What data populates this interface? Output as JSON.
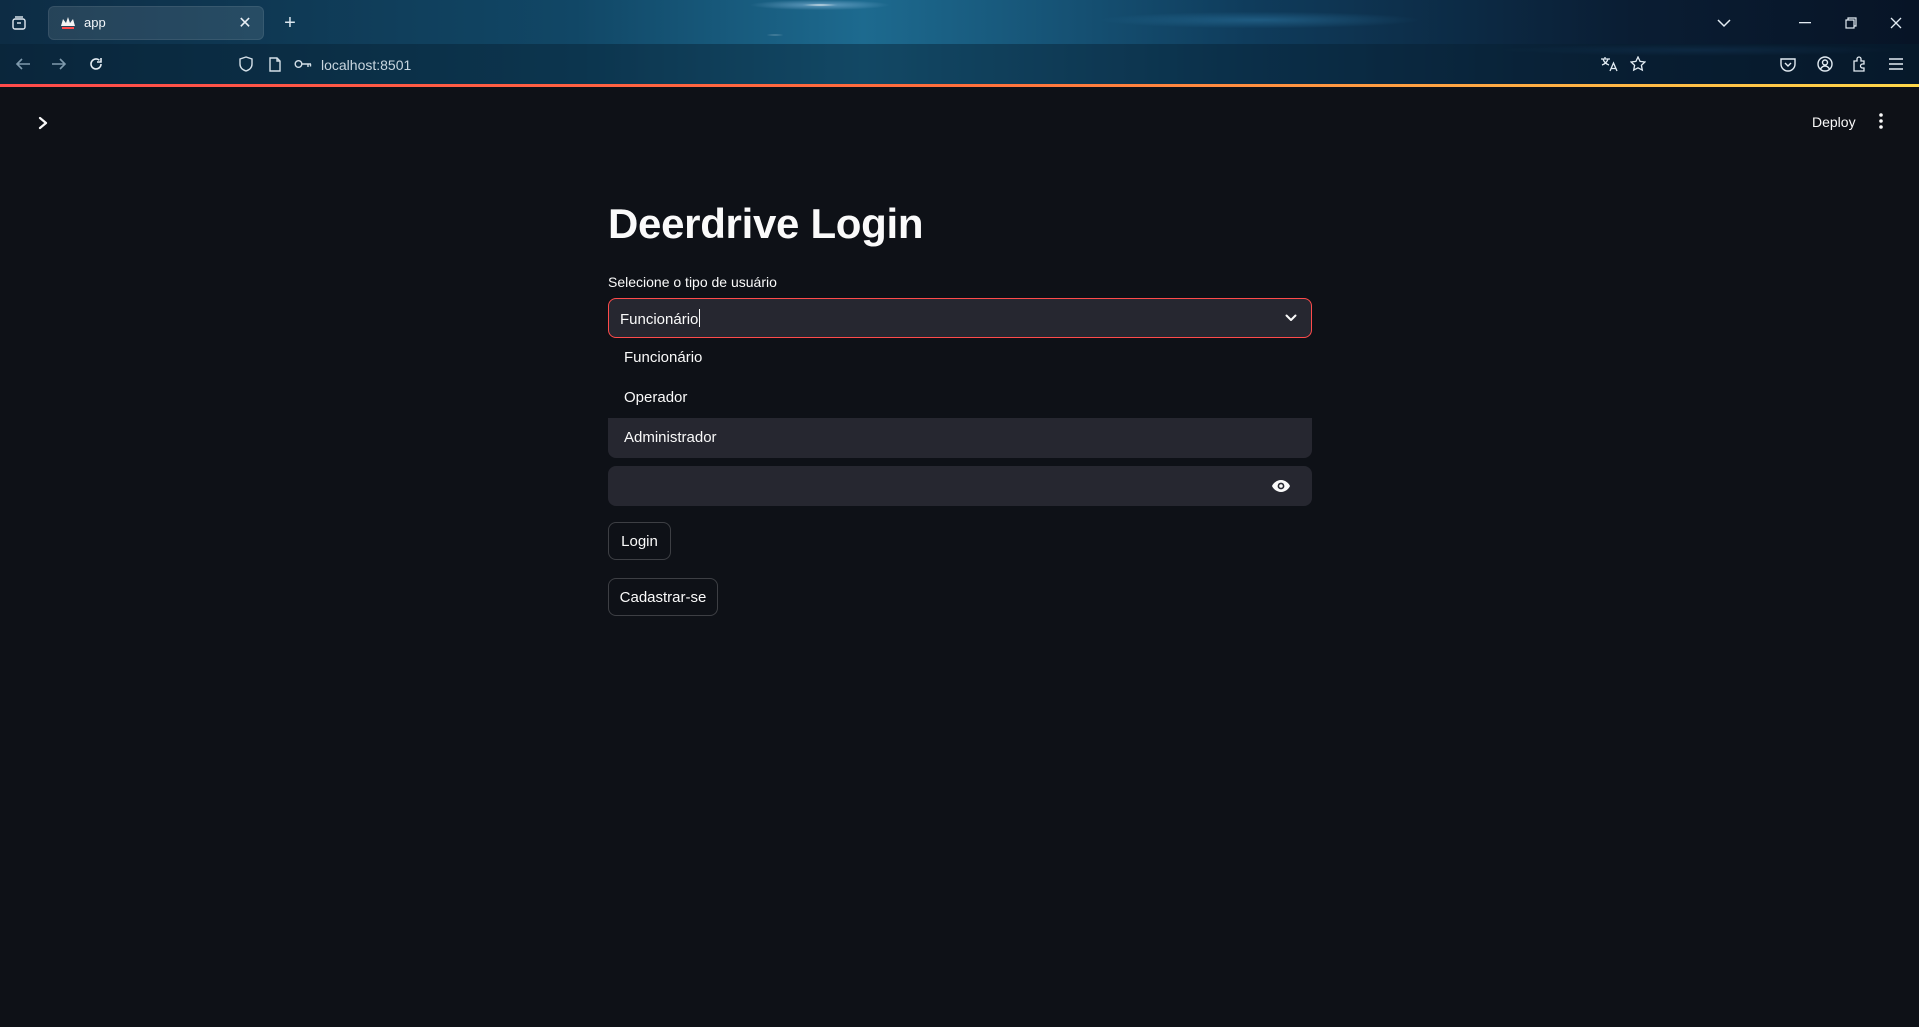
{
  "browser": {
    "tab_title": "app",
    "url": "localhost:8501"
  },
  "app": {
    "deploy_label": "Deploy",
    "title": "Deerdrive Login",
    "user_type": {
      "label": "Selecione o tipo de usuário",
      "value": "Funcionário",
      "options": [
        "Funcionário",
        "Operador",
        "Administrador"
      ],
      "highlighted_index": 2
    },
    "password": {
      "value": "",
      "toggle_icon": "eye-icon"
    },
    "buttons": {
      "login": "Login",
      "signup": "Cadastrar-se"
    }
  },
  "colors": {
    "background": "#0e1117",
    "input_bg": "#262730",
    "focus_border": "#ff4b4b",
    "text": "#fafafa"
  }
}
